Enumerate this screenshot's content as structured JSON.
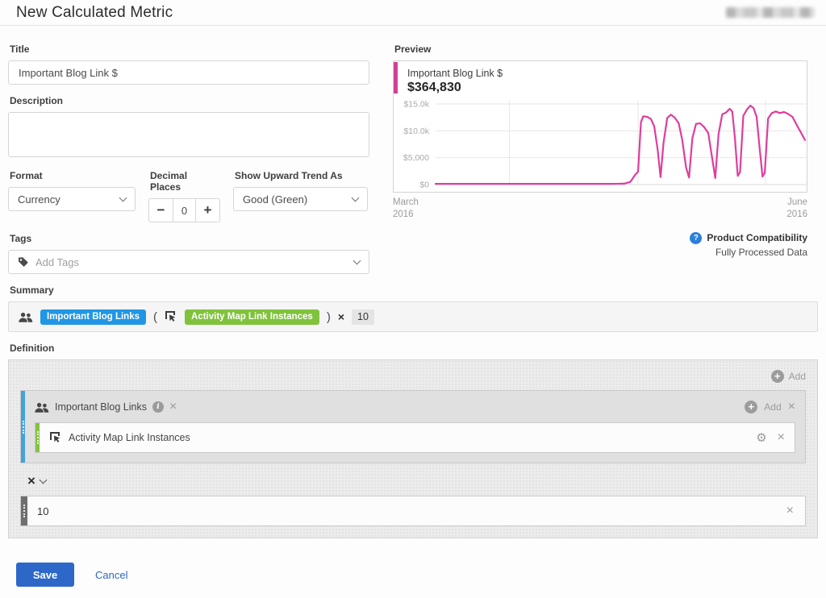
{
  "page": {
    "title": "New Calculated Metric"
  },
  "icons": {
    "close": "×",
    "plus": "+",
    "minus": "−",
    "info": "i",
    "help": "?",
    "gear": "⚙"
  },
  "form": {
    "title_label": "Title",
    "title_value": "Important Blog Link $",
    "description_label": "Description",
    "description_value": "",
    "format_label": "Format",
    "format_value": "Currency",
    "decimal_label": "Decimal Places",
    "decimal_value": "0",
    "trend_label": "Show Upward Trend As",
    "trend_value": "Good (Green)",
    "tags_label": "Tags",
    "tags_placeholder": "Add Tags"
  },
  "preview": {
    "label": "Preview",
    "compat_title": "Product Compatibility",
    "compat_subtitle": "Fully Processed Data"
  },
  "chart_data": {
    "type": "line",
    "title": "Important Blog Link $",
    "total_label": "$364,830",
    "line_color": "#df3d9d",
    "accent_color": "#d33f95",
    "grid_on": true,
    "ylim": [
      0,
      16500
    ],
    "y_ticks": [
      {
        "label": "$15.0k",
        "value": 15000
      },
      {
        "label": "$10.0k",
        "value": 10000
      },
      {
        "label": "$5,000",
        "value": 5000
      },
      {
        "label": "$0",
        "value": 0
      }
    ],
    "x_labels": [
      {
        "month": "March",
        "year": "2016"
      },
      {
        "month": "June",
        "year": "2016"
      }
    ],
    "x_gridline_fractions": [
      0.2,
      0.548,
      0.893
    ],
    "points": [
      [
        0.0,
        140
      ],
      [
        0.12,
        140
      ],
      [
        0.25,
        140
      ],
      [
        0.38,
        140
      ],
      [
        0.48,
        140
      ],
      [
        0.51,
        160
      ],
      [
        0.527,
        500
      ],
      [
        0.54,
        1800
      ],
      [
        0.548,
        2400
      ],
      [
        0.556,
        11600
      ],
      [
        0.562,
        12700
      ],
      [
        0.573,
        12600
      ],
      [
        0.583,
        12200
      ],
      [
        0.592,
        10800
      ],
      [
        0.601,
        6500
      ],
      [
        0.609,
        1400
      ],
      [
        0.617,
        7800
      ],
      [
        0.627,
        12400
      ],
      [
        0.637,
        13000
      ],
      [
        0.647,
        12500
      ],
      [
        0.658,
        11400
      ],
      [
        0.668,
        8200
      ],
      [
        0.678,
        3200
      ],
      [
        0.686,
        1300
      ],
      [
        0.695,
        8600
      ],
      [
        0.705,
        11300
      ],
      [
        0.716,
        11400
      ],
      [
        0.727,
        10700
      ],
      [
        0.738,
        9600
      ],
      [
        0.748,
        5200
      ],
      [
        0.757,
        1200
      ],
      [
        0.766,
        9400
      ],
      [
        0.776,
        13100
      ],
      [
        0.786,
        13400
      ],
      [
        0.796,
        14100
      ],
      [
        0.803,
        13600
      ],
      [
        0.81,
        8800
      ],
      [
        0.818,
        1600
      ],
      [
        0.824,
        2300
      ],
      [
        0.833,
        12800
      ],
      [
        0.843,
        14000
      ],
      [
        0.852,
        14700
      ],
      [
        0.861,
        14200
      ],
      [
        0.869,
        12600
      ],
      [
        0.877,
        6800
      ],
      [
        0.885,
        1500
      ],
      [
        0.891,
        2200
      ],
      [
        0.9,
        12300
      ],
      [
        0.91,
        13300
      ],
      [
        0.921,
        13600
      ],
      [
        0.932,
        13300
      ],
      [
        0.943,
        13500
      ],
      [
        0.953,
        13200
      ],
      [
        0.966,
        12600
      ],
      [
        0.98,
        10800
      ],
      [
        1.0,
        8300
      ]
    ]
  },
  "summary": {
    "label": "Summary",
    "metric_pill": "Important Blog Links",
    "open_paren": "(",
    "dimension_pill": "Activity Map Link Instances",
    "close_paren": ")",
    "operator": "×",
    "operand": "10"
  },
  "definition": {
    "label": "Definition",
    "add_label": "Add",
    "container": {
      "title": "Important Blog Links",
      "add_label": "Add",
      "row_label": "Activity Map Link Instances"
    },
    "operator": "×",
    "operand": "10"
  },
  "footer": {
    "save": "Save",
    "cancel": "Cancel"
  }
}
